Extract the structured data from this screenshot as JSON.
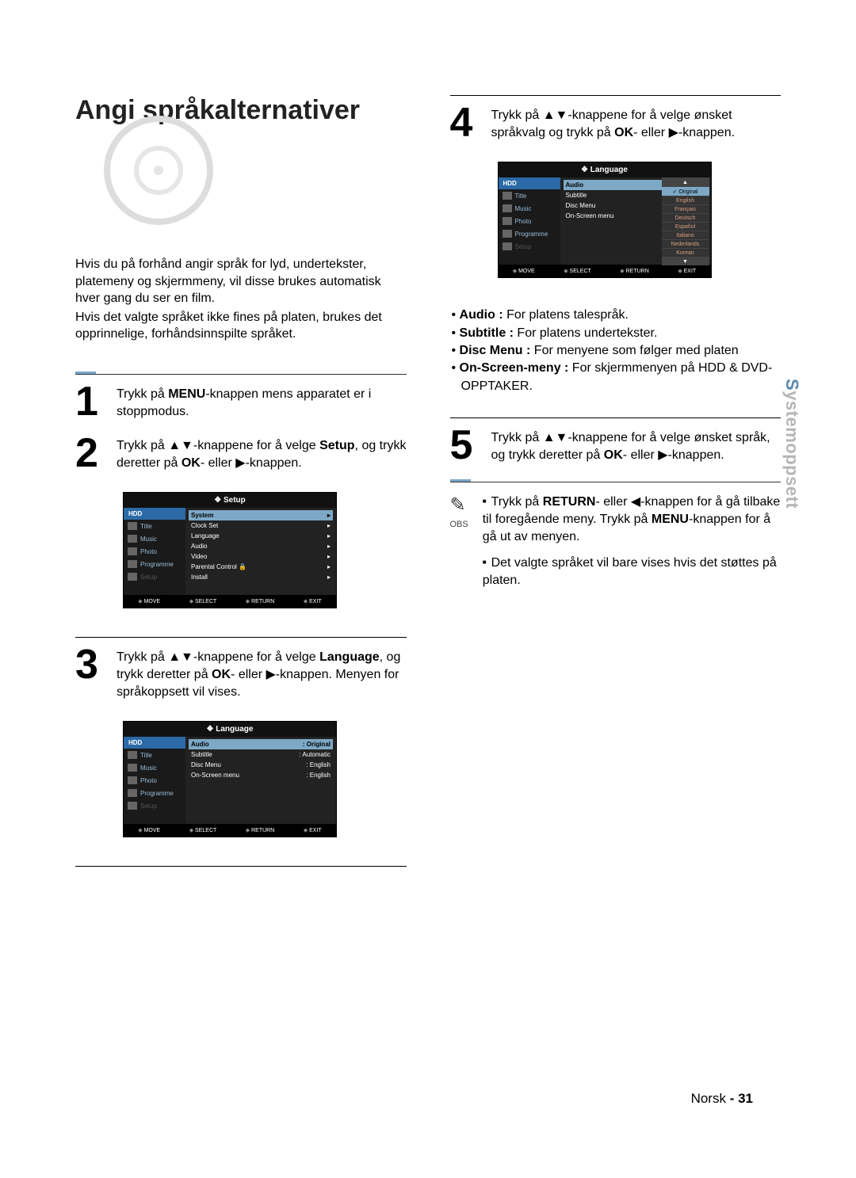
{
  "title": "Angi språkalternativer",
  "intro": [
    "Hvis du på forhånd angir språk for lyd, undertekster, platemeny og skjermmeny, vil disse brukes automatisk hver gang du ser en film.",
    "Hvis det valgte språket ikke fines på platen, brukes det opprinnelige, forhåndsinnspilte språket."
  ],
  "steps": {
    "1": {
      "pre": "Trykk på ",
      "b1": "MENU",
      "mid": "-knappen mens apparatet er i stoppmodus."
    },
    "2": {
      "pre": "Trykk på ▲▼-knappene for å velge ",
      "b1": "Setup",
      "mid": ", og trykk deretter på ",
      "b2": "OK",
      "suf": "- eller ▶-knappen."
    },
    "3": {
      "pre": "Trykk på ▲▼-knappene for å velge ",
      "b1": "Language",
      "mid": ", og trykk deretter på ",
      "b2": "OK",
      "suf": "- eller ▶-knappen. Menyen for språkoppsett vil vises."
    },
    "4": {
      "pre": "Trykk på ▲▼-knappene for å velge ønsket språkvalg og trykk på ",
      "b1": "OK",
      "suf": "- eller ▶-knappen."
    },
    "5": {
      "pre": "Trykk på ▲▼-knappene for å velge ønsket språk, og trykk deretter på ",
      "b1": "OK",
      "suf": "- eller ▶-knappen."
    }
  },
  "definitions": {
    "audio_l": "Audio :",
    "audio_v": " For platens talespråk.",
    "sub_l": "Subtitle :",
    "sub_v": " For platens undertekster.",
    "disc_l": "Disc Menu :",
    "disc_v": " For menyene som følger med platen",
    "osd_l": "On-Screen-meny :",
    "osd_v": " For skjermmenyen på HDD & DVD-OPPTAKER."
  },
  "obs": {
    "label": "OBS",
    "n1a": "Trykk på ",
    "n1b1": "RETURN",
    "n1b": "- eller ◀-knappen for å gå tilbake til foregående meny. Trykk på ",
    "n1b2": "MENU",
    "n1c": "-knappen for å gå ut av menyen.",
    "n2": "Det valgte språket vil bare vises hvis det støttes på platen."
  },
  "osd_common": {
    "hdd": "HDD",
    "nav": [
      "Title",
      "Music",
      "Photo",
      "Programme",
      "Setup"
    ],
    "footer": [
      "MOVE",
      "SELECT",
      "RETURN",
      "EXIT"
    ]
  },
  "osd_setup": {
    "title": "❖  Setup",
    "items": [
      "System",
      "Clock Set",
      "Language",
      "Audio",
      "Video",
      "Parental Control  🔒",
      "Install"
    ]
  },
  "osd_language": {
    "title": "❖  Language",
    "rows": [
      {
        "k": "Audio",
        "v": ": Original"
      },
      {
        "k": "Subtitle",
        "v": ": Automatic"
      },
      {
        "k": "Disc Menu",
        "v": ": English"
      },
      {
        "k": "On-Screen menu",
        "v": ": English"
      }
    ]
  },
  "osd_language_open": {
    "title": "❖  Language",
    "rows": [
      "Audio",
      "Subtitle",
      "Disc Menu",
      "On-Screen menu"
    ],
    "dropdown": [
      "▲",
      "✓ Original",
      "English",
      "Français",
      "Deutsch",
      "Español",
      "Italiano",
      "Nederlands",
      "Korean",
      "▼"
    ]
  },
  "sidetab": {
    "first": "S",
    "rest": "ystemoppsett"
  },
  "footer": {
    "lang": "Norsk",
    "dash": " - ",
    "page": "31"
  }
}
